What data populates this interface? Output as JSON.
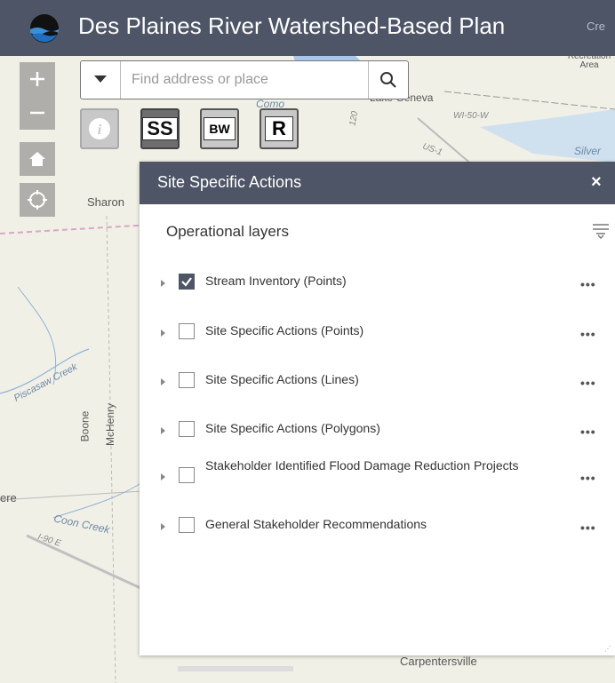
{
  "header": {
    "title": "Des Plaines River Watershed-Based Plan",
    "right_link": "Cre"
  },
  "map": {
    "labels": {
      "recreation_area": "Recreation Area",
      "lake_geneva": "Lake Geneva",
      "como": "Como",
      "wi50": "WI-50-W",
      "us": "US-1",
      "silver": "Silver",
      "sharon": "Sharon",
      "piscasaw": "Piscasaw Creek",
      "boone": "Boone",
      "mchenry": "McHenry",
      "ere": "ere",
      "coon_creek": "Coon Creek",
      "i90": "I-90 E",
      "carpentersville": "Carpentersville",
      "route_120": "120"
    }
  },
  "search": {
    "placeholder": "Find address or place"
  },
  "widgets": {
    "ss": "SS",
    "bw": "BW",
    "r": "R"
  },
  "panel": {
    "title": "Site Specific Actions",
    "close": "×",
    "section_title": "Operational layers",
    "layers": [
      {
        "label": "Stream Inventory (Points)",
        "checked": true
      },
      {
        "label": "Site Specific Actions (Points)",
        "checked": false
      },
      {
        "label": "Site Specific Actions (Lines)",
        "checked": false
      },
      {
        "label": "Site Specific Actions (Polygons)",
        "checked": false
      },
      {
        "label": "Stakeholder Identified Flood Damage Reduction Projects",
        "checked": false
      },
      {
        "label": "General Stakeholder Recommendations",
        "checked": false
      }
    ],
    "more": "•••"
  },
  "colors": {
    "header_bg": "#4d5566",
    "panel_header_bg": "#4d5566"
  }
}
